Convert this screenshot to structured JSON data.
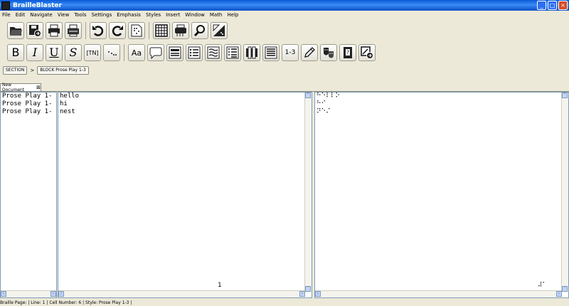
{
  "window": {
    "title": "BrailleBlaster",
    "min_label": "_",
    "max_label": "□",
    "close_label": "×"
  },
  "menu": [
    "File",
    "Edit",
    "Navigate",
    "View",
    "Tools",
    "Settings",
    "Emphasis",
    "Styles",
    "Insert",
    "Window",
    "Math",
    "Help"
  ],
  "toolbar2": {
    "bold": "B",
    "italic": "I",
    "underline": "U",
    "script": "S",
    "tn": "[TN]",
    "aa": "Aa",
    "range": "1-3"
  },
  "breadcrumb": {
    "section": "SECTION",
    "separator": ">",
    "block": "BLOCK Prose Play 1-3"
  },
  "tab": {
    "label": "New Document",
    "close": "⊠"
  },
  "style_pane": {
    "lines": [
      "Prose Play 1-",
      "Prose Play 1-",
      "Prose Play 1-"
    ]
  },
  "text_pane": {
    "lines": [
      "hello",
      "hi",
      "nest"
    ],
    "page_number": "1"
  },
  "braille_pane": {
    "lines": [
      "⠓⠑⠇⠇⠕",
      "⠓⠊",
      "⠝⠑⠌"
    ],
    "page_number": "⠼⠁"
  },
  "status": "Braille Page:  | Line: 1 | Cell Number: 6 | Style: Prose Play 1-3 |"
}
